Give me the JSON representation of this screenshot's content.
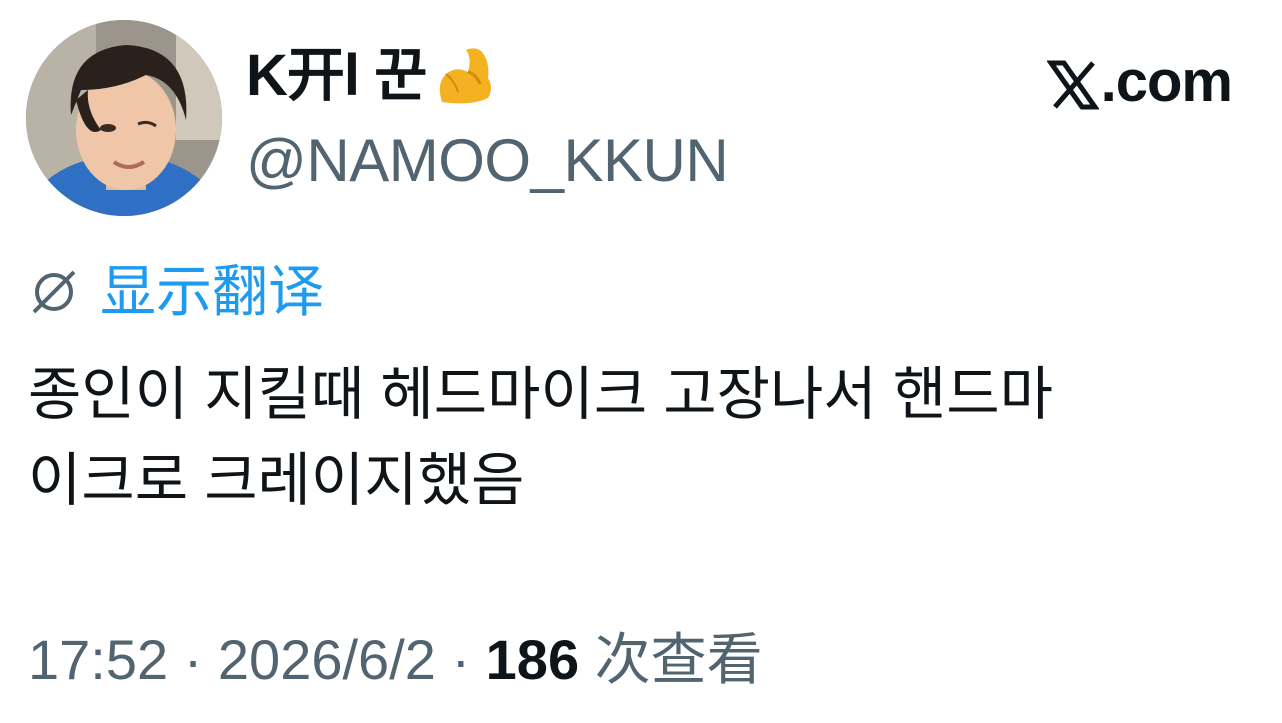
{
  "author": {
    "display_name": "K开l 꾼",
    "name_emoji": "flexed-biceps-icon",
    "handle": "@NAMOO_KKUN"
  },
  "brand": {
    "site_label": ".com",
    "logo": "x-logo-icon"
  },
  "translate": {
    "label": "显示翻译",
    "icon": "globe-icon",
    "color": "#1d9bf0"
  },
  "tweet": {
    "line1": "종인이 지킬때 헤드마이크 고장나서 핸드마",
    "line2": "이크로 크레이지했음"
  },
  "meta": {
    "time": "17:52",
    "separator1": " · ",
    "date": "2026/6/2",
    "separator2": " · ",
    "views_count": "186",
    "views_label": " 次查看"
  },
  "colors": {
    "text_primary": "#0f1419",
    "text_secondary": "#536471",
    "link": "#1d9bf0",
    "background": "#ffffff"
  }
}
